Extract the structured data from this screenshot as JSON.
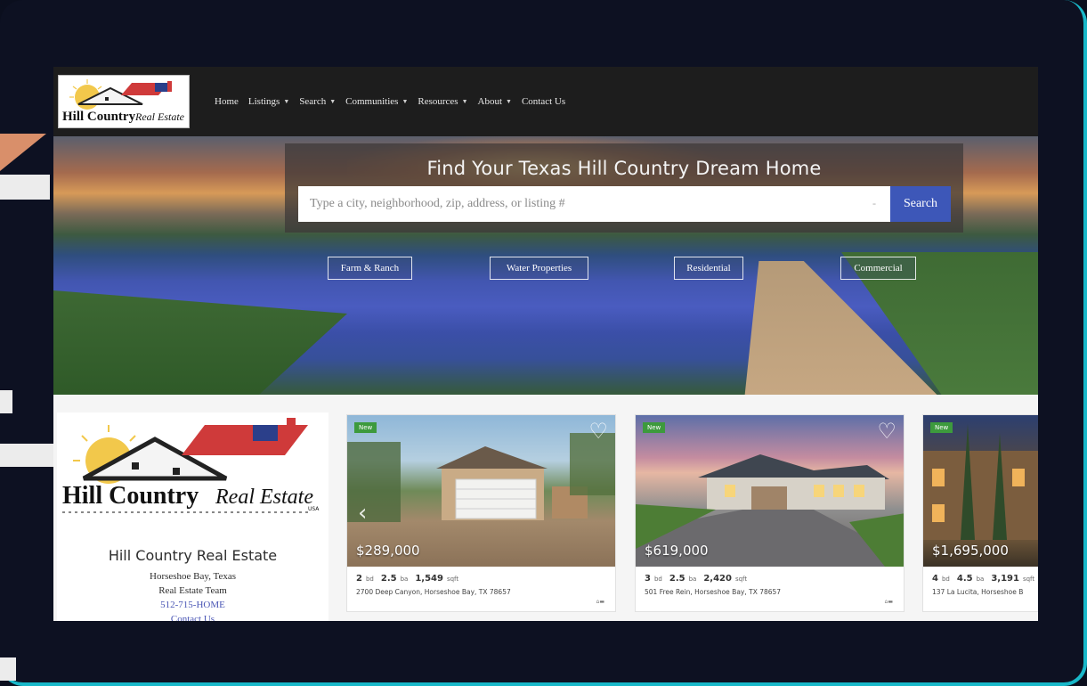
{
  "colors": {
    "nav_bg": "#1d1d1d",
    "search_button": "#3d57b8",
    "frame_accent": "#19b8c9",
    "corner_accent": "#d98f6a",
    "link": "#4a56b5"
  },
  "logo": {
    "title": "Hill Country",
    "script": "Real Estate",
    "suffix": "USA"
  },
  "nav": {
    "items": [
      {
        "label": "Home",
        "dropdown": false
      },
      {
        "label": "Listings",
        "dropdown": true
      },
      {
        "label": "Search",
        "dropdown": true
      },
      {
        "label": "Communities",
        "dropdown": true
      },
      {
        "label": "Resources",
        "dropdown": true
      },
      {
        "label": "About",
        "dropdown": true
      },
      {
        "label": "Contact Us",
        "dropdown": false
      }
    ]
  },
  "hero": {
    "title": "Find Your Texas Hill Country Dream Home",
    "search_placeholder": "Type a city, neighborhood, zip, address, or listing #",
    "search_button": "Search",
    "categories": [
      "Farm & Ranch",
      "Water Properties",
      "Residential",
      "Commercial"
    ]
  },
  "agent": {
    "name": "Hill Country Real Estate",
    "location": "Horseshoe Bay, Texas",
    "team": "Real Estate Team",
    "phone": "512-715-HOME",
    "contact": "Contact Us"
  },
  "listings": [
    {
      "badge": "New",
      "price": "$289,000",
      "beds": "2",
      "baths": "2.5",
      "sqft": "1,549",
      "address": "2700 Deep Canyon, Horseshoe Bay, TX 78657"
    },
    {
      "badge": "New",
      "price": "$619,000",
      "beds": "3",
      "baths": "2.5",
      "sqft": "2,420",
      "address": "501 Free Rein, Horseshoe Bay, TX 78657"
    },
    {
      "badge": "New",
      "price": "$1,695,000",
      "beds": "4",
      "baths": "4.5",
      "sqft": "3,191",
      "address": "137 La Lucita, Horseshoe B"
    }
  ],
  "spec_units": {
    "beds": "bd",
    "baths": "ba",
    "sqft": "sqft"
  }
}
